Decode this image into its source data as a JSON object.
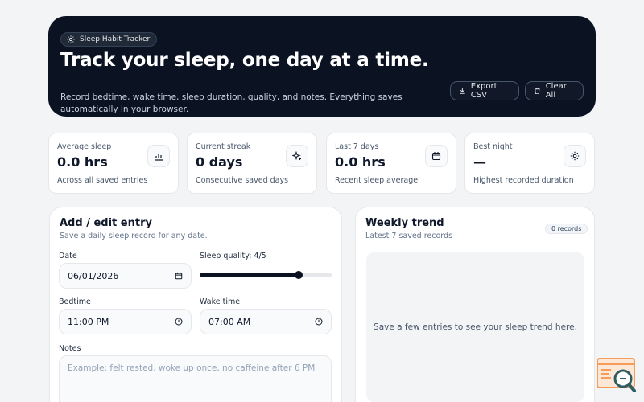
{
  "header": {
    "badge": "Sleep Habit Tracker",
    "title": "Track your sleep, one day at a time.",
    "description": "Record bedtime, wake time, sleep duration, quality, and notes. Everything saves automatically in your browser.",
    "export_label": "Export CSV",
    "clear_label": "Clear All"
  },
  "stats": [
    {
      "label": "Average sleep",
      "value": "0.0 hrs",
      "sub": "Across all saved entries",
      "icon": "bar-chart-icon"
    },
    {
      "label": "Current streak",
      "value": "0 days",
      "sub": "Consecutive saved days",
      "icon": "sparkle-icon"
    },
    {
      "label": "Last 7 days",
      "value": "0.0 hrs",
      "sub": "Recent sleep average",
      "icon": "calendar-icon"
    },
    {
      "label": "Best night",
      "value": "—",
      "sub": "Highest recorded duration",
      "icon": "sun-icon"
    }
  ],
  "form": {
    "title": "Add / edit entry",
    "subtitle": "Save a daily sleep record for any date.",
    "date_label": "Date",
    "date_value": "06/01/2026",
    "quality_label": "Sleep quality: 4/5",
    "quality_value": 4,
    "quality_max": 5,
    "bedtime_label": "Bedtime",
    "bedtime_value": "11:00 PM",
    "wake_label": "Wake time",
    "wake_value": "07:00 AM",
    "notes_label": "Notes",
    "notes_placeholder": "Example: felt rested, woke up once, no caffeine after 6 PM"
  },
  "trend": {
    "title": "Weekly trend",
    "subtitle": "Latest 7 saved records",
    "badge": "0 records",
    "empty_text": "Save a few entries to see your sleep trend here."
  },
  "colors": {
    "hero_bg": "#0b1221",
    "accent": "#0b1221",
    "corner_orange": "#f59e5b",
    "corner_teal": "#2f5d62"
  }
}
